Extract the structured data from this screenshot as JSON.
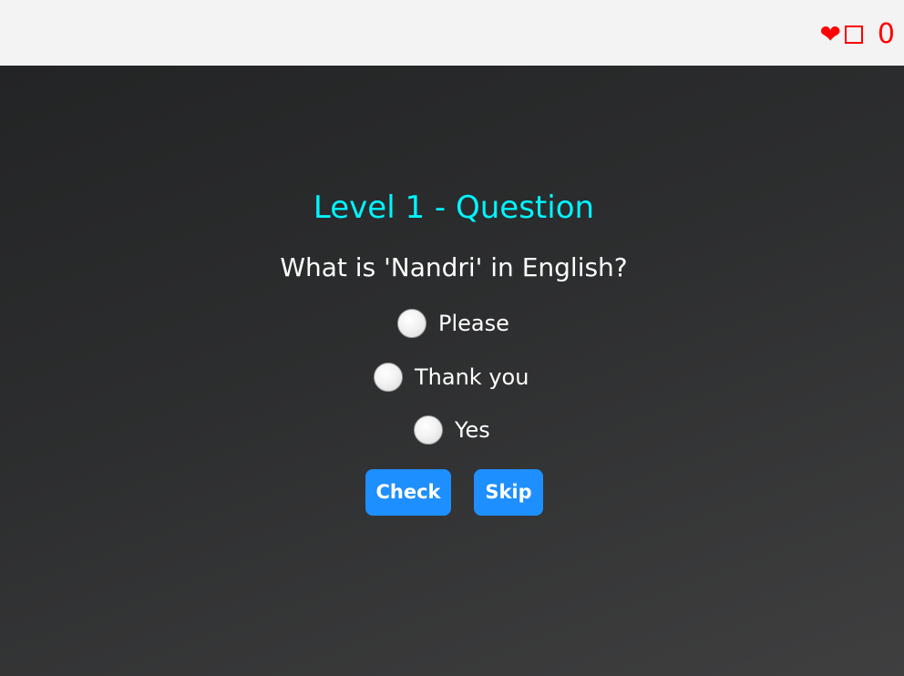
{
  "header": {
    "heart_icon": "❤",
    "box_icon": "square-outline",
    "score": "0",
    "accent_color": "#ff0000"
  },
  "quiz": {
    "title": "Level 1 - Question",
    "question": "What is 'Nandri' in English?",
    "options": [
      {
        "label": "Please",
        "selected": false
      },
      {
        "label": "Thank you",
        "selected": false
      },
      {
        "label": "Yes",
        "selected": false
      }
    ],
    "check_label": "Check",
    "skip_label": "Skip",
    "title_color": "#00f5ff",
    "button_color": "#1e8ffe"
  }
}
